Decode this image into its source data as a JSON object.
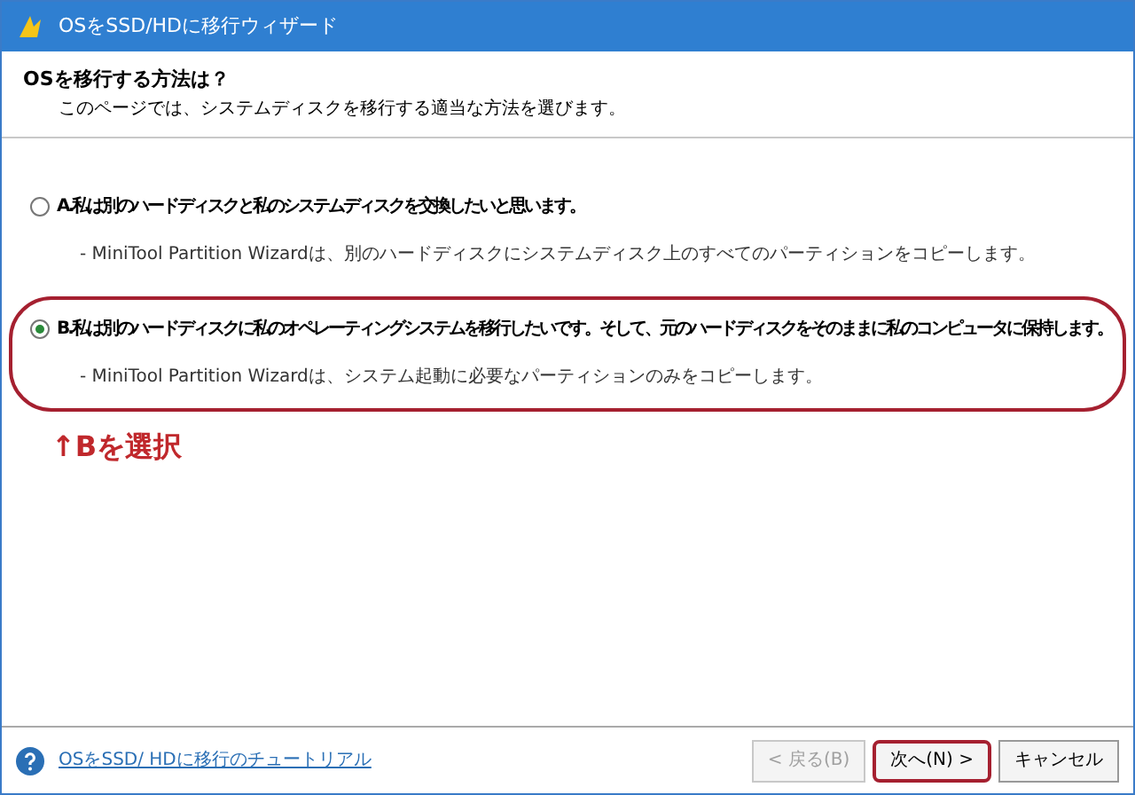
{
  "window": {
    "title": "OSをSSD/HDに移行ウィザード"
  },
  "header": {
    "title": "OSを移行する方法は？",
    "subtitle": "このページでは、システムディスクを移行する適当な方法を選びます。"
  },
  "options": [
    {
      "label": "A.私は別のハードディスクと私のシステムディスクを交換したいと思います。",
      "description": "- MiniTool Partition Wizardは、別のハードディスクにシステムディスク上のすべてのパーティションをコピーします。",
      "selected": false,
      "highlighted": false
    },
    {
      "label": "B.私は別のハードディスクに私のオペレーティングシステムを移行したいです。そして、元のハードディスクをそのままに私のコンピュータに保持します。",
      "description": "- MiniTool Partition Wizardは、システム起動に必要なパーティションのみをコピーします。",
      "selected": true,
      "highlighted": true
    }
  ],
  "annotation": "↑Bを選択",
  "footer": {
    "help_link": "OSをSSD/ HDに移行のチュートリアル",
    "buttons": [
      {
        "label": "< 戻る(B)",
        "disabled": true,
        "highlighted": false
      },
      {
        "label": "次へ(N) >",
        "disabled": false,
        "highlighted": true
      },
      {
        "label": "キャンセル",
        "disabled": false,
        "highlighted": false
      }
    ]
  }
}
